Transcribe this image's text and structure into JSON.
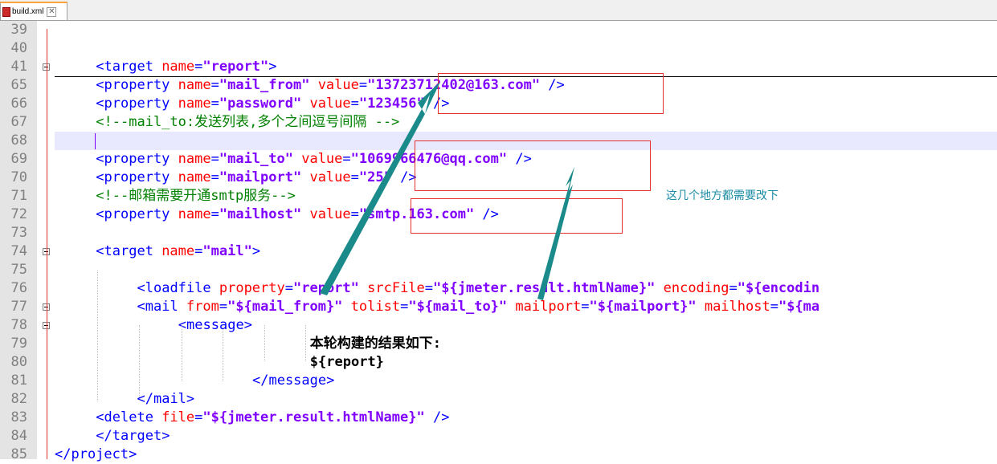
{
  "tab": {
    "filename": "build.xml",
    "close": "✕",
    "icon": "xml-file-icon"
  },
  "lines": [
    {
      "num": "39",
      "text": ""
    },
    {
      "num": "40",
      "text": ""
    },
    {
      "num": "41",
      "text": "<target name=\"report\">"
    },
    {
      "num": "65",
      "text": "<property name=\"mail_from\" value=\"13723712402@163.com\" />"
    },
    {
      "num": "66",
      "text": "<property name=\"password\" value=\"123456\" />"
    },
    {
      "num": "67",
      "text": "<!--mail_to:发送列表,多个之间逗号间隔 -->"
    },
    {
      "num": "68",
      "text": ""
    },
    {
      "num": "69",
      "text": "<property name=\"mail_to\" value=\"1069966476@qq.com\" />"
    },
    {
      "num": "70",
      "text": "<property name=\"mailport\" value=\"25\" />"
    },
    {
      "num": "71",
      "text": "<!--邮箱需要开通smtp服务-->"
    },
    {
      "num": "72",
      "text": "<property name=\"mailhost\" value=\"smtp.163.com\" />"
    },
    {
      "num": "73",
      "text": ""
    },
    {
      "num": "74",
      "text": "<target name=\"mail\">"
    },
    {
      "num": "75",
      "text": ""
    },
    {
      "num": "76",
      "text": "<loadfile property=\"report\" srcFile=\"${jmeter.result.htmlName}\" encoding=\"${encodin"
    },
    {
      "num": "77",
      "text": "<mail from=\"${mail_from}\" tolist=\"${mail_to}\" mailport=\"${mailport}\" mailhost=\"${ma"
    },
    {
      "num": "78",
      "text": "<message>"
    },
    {
      "num": "79",
      "text": "本轮构建的结果如下:"
    },
    {
      "num": "80",
      "text": "${report}"
    },
    {
      "num": "81",
      "text": "</message>"
    },
    {
      "num": "82",
      "text": "</mail>"
    },
    {
      "num": "83",
      "text": "<delete file=\"${jmeter.result.htmlName}\" />"
    },
    {
      "num": "84",
      "text": "</target>"
    },
    {
      "num": "85",
      "text": "</project>"
    }
  ],
  "annotation": {
    "note": "这几个地方都需要改下",
    "color": "#1a8ca4"
  },
  "colors": {
    "tag": "#0000ff",
    "attr": "#ff0000",
    "value": "#8000ff",
    "comment": "#008000",
    "box": "#e53030",
    "arrow": "#1a8a8a"
  }
}
